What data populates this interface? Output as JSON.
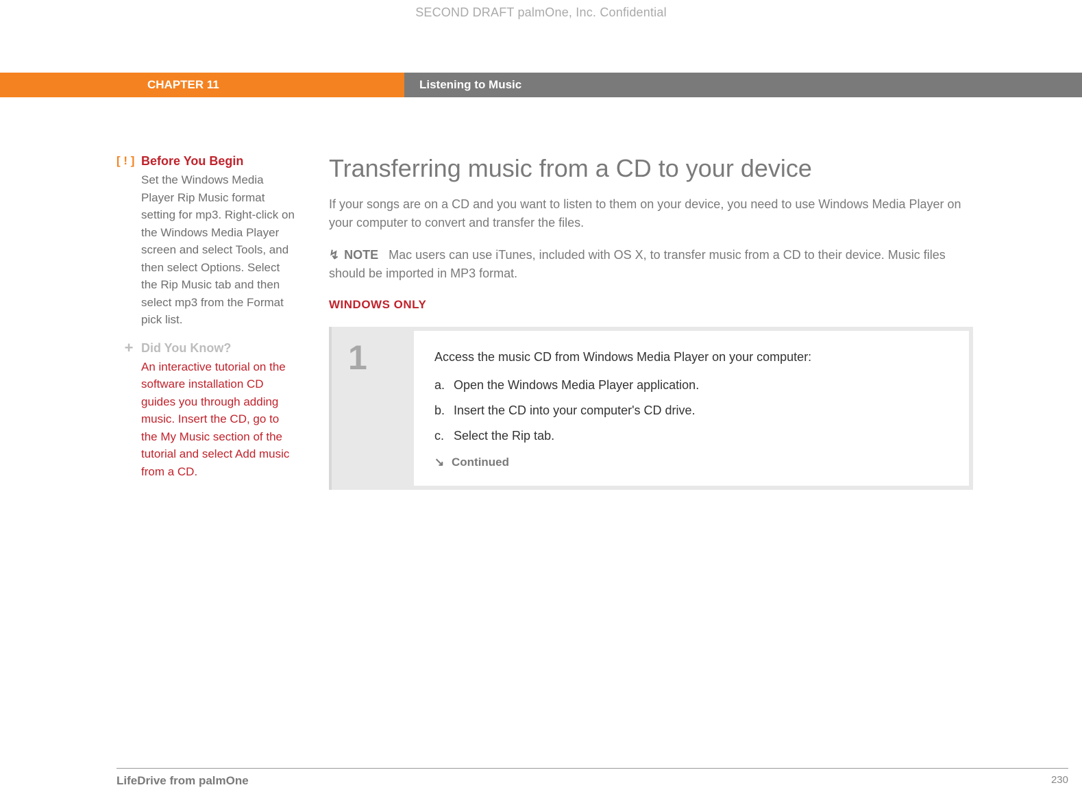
{
  "watermark": "SECOND DRAFT palmOne, Inc.  Confidential",
  "header": {
    "chapter": "CHAPTER 11",
    "title": "Listening to Music"
  },
  "sidebar": {
    "before": {
      "marker": "[ ! ]",
      "title": "Before You Begin",
      "body": "Set the Windows Media Player Rip Music format setting for mp3. Right-click on the Windows Media Player screen and select Tools, and then select Options. Select the Rip Music tab and then select mp3 from the Format pick list."
    },
    "didyouknow": {
      "marker": "+",
      "title": "Did You Know?",
      "body": "An interactive tutorial on the software installation CD guides you through adding music. Insert the CD, go to the My Music section of the tutorial and select Add music from a CD."
    }
  },
  "main": {
    "title": "Transferring music from a CD to your device",
    "intro": "If your songs are on a CD and you want to listen to them on your device, you need to use Windows Media Player on your computer to convert and transfer the files.",
    "note_label": "NOTE",
    "note_text": "Mac users can use iTunes, included with OS X, to transfer music from a CD to their device. Music files should be imported in MP3 format.",
    "windows_only": "WINDOWS ONLY",
    "step": {
      "number": "1",
      "lead": "Access the music CD from Windows Media Player on your computer:",
      "items": [
        {
          "letter": "a.",
          "text": "Open the Windows Media Player application."
        },
        {
          "letter": "b.",
          "text": "Insert the CD into your computer's CD drive."
        },
        {
          "letter": "c.",
          "text": "Select the Rip tab."
        }
      ],
      "continued": "Continued"
    }
  },
  "footer": {
    "product": "LifeDrive from palmOne",
    "page": "230"
  }
}
